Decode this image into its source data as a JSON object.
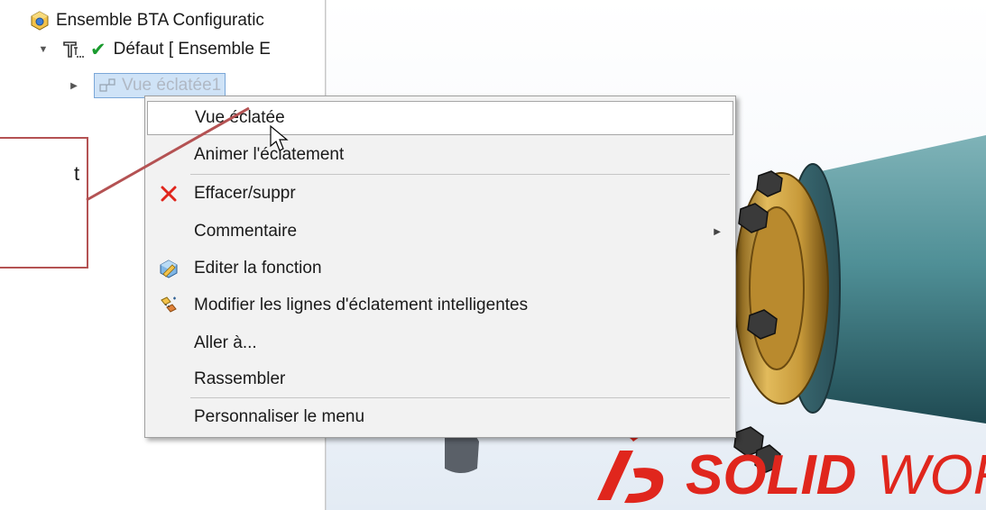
{
  "tree": {
    "root_label": "Ensemble BTA Configuratic",
    "config_label": "Défaut [ Ensemble E",
    "exploded_label": "Vue éclatée1"
  },
  "context_menu": {
    "items": [
      {
        "label": "Vue éclatée",
        "highlighted": true
      },
      {
        "label": "Animer l'éclatement"
      },
      {
        "label": "Effacer/suppr",
        "icon": "delete-x-icon"
      },
      {
        "label": "Commentaire",
        "submenu": true
      },
      {
        "label": "Editer la fonction",
        "icon": "edit-feature-icon"
      },
      {
        "label": "Modifier les lignes d'éclatement intelligentes",
        "icon": "smart-explode-lines-icon"
      },
      {
        "label": "Aller à..."
      },
      {
        "label": "Rassembler"
      },
      {
        "label": "Personnaliser le menu"
      }
    ]
  },
  "callout": {
    "text": "t"
  },
  "logo": {
    "prefix": "SOLID",
    "suffix": "WOR"
  },
  "colors": {
    "callout_border": "#b45253",
    "delete_red": "#e0261d",
    "check_green": "#1a9b2e",
    "logo_red": "#e0261d",
    "flange_gold": "#c89a3a",
    "tube_teal": "#4f8f96"
  }
}
